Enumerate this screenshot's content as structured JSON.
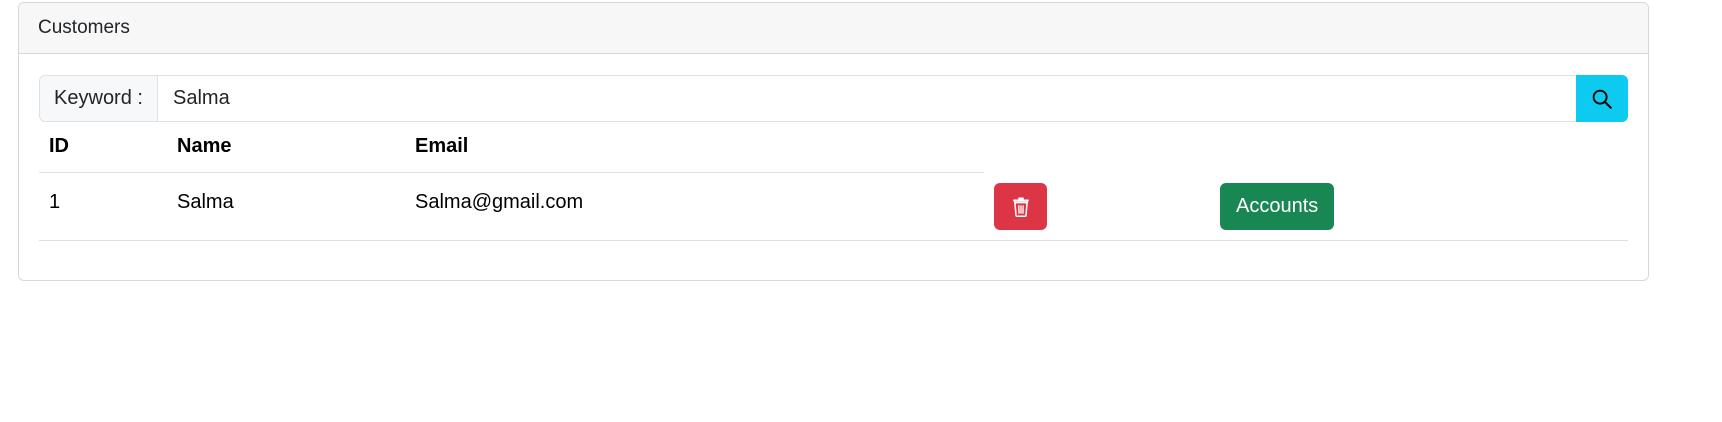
{
  "card": {
    "title": "Customers"
  },
  "search": {
    "label": "Keyword :",
    "value": "Salma",
    "button_icon": "search-icon"
  },
  "table": {
    "headers": [
      "ID",
      "Name",
      "Email"
    ],
    "rows": [
      {
        "id": "1",
        "name": "Salma",
        "email": "Salma@gmail.com",
        "delete_icon": "trash-icon",
        "accounts_label": "Accounts"
      }
    ]
  },
  "colors": {
    "search_button": "#0dcaf0",
    "delete_button": "#dc3545",
    "accounts_button": "#198754"
  }
}
